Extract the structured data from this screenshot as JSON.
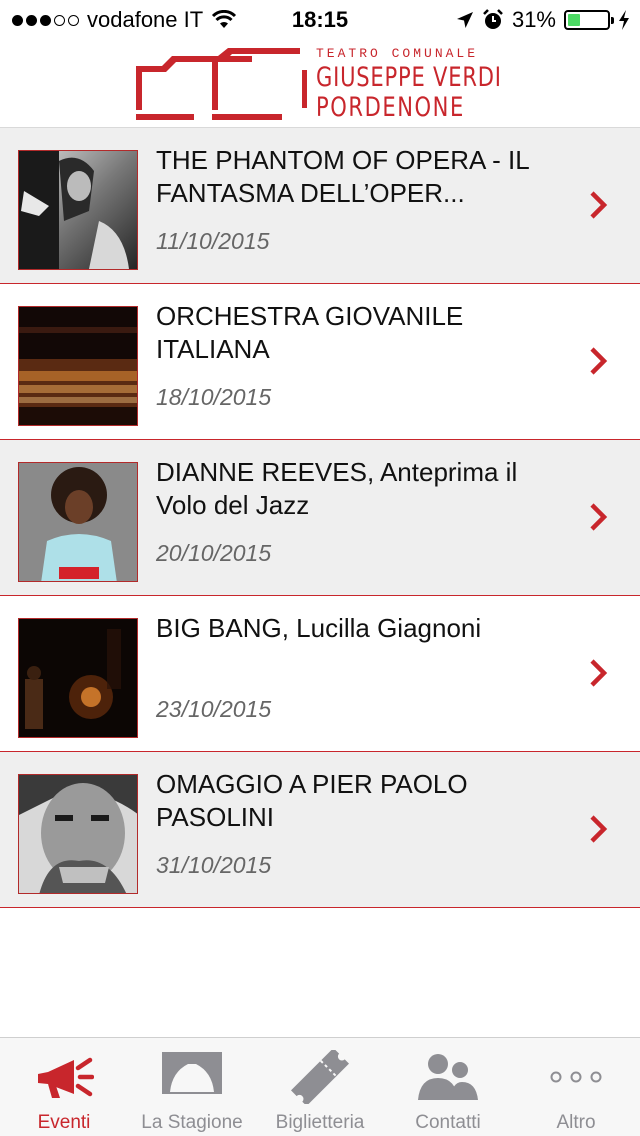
{
  "status_bar": {
    "carrier": "vodafone IT",
    "time": "18:15",
    "battery": "31%",
    "battery_level": 0.31
  },
  "header": {
    "logo_line1": "TEATRO COMUNALE",
    "logo_line2": "GIUSEPPE VERDI",
    "logo_line3": "PORDENONE"
  },
  "events": [
    {
      "title": "THE PHANTOM OF OPERA - IL FANTASMA DELL’OPER...",
      "date": "11/10/2015"
    },
    {
      "title": "ORCHESTRA GIOVANILE ITALIANA",
      "date": "18/10/2015"
    },
    {
      "title": "DIANNE REEVES, Anteprima il Volo del Jazz",
      "date": "20/10/2015"
    },
    {
      "title": "BIG BANG, Lucilla Giagnoni",
      "date": "23/10/2015"
    },
    {
      "title": "OMAGGIO A PIER PAOLO PASOLINI",
      "date": "31/10/2015"
    }
  ],
  "tabs": [
    {
      "label": "Eventi",
      "icon": "megaphone-icon",
      "active": true
    },
    {
      "label": "La Stagione",
      "icon": "stage-icon",
      "active": false
    },
    {
      "label": "Biglietteria",
      "icon": "ticket-icon",
      "active": false
    },
    {
      "label": "Contatti",
      "icon": "people-icon",
      "active": false
    },
    {
      "label": "Altro",
      "icon": "more-icon",
      "active": false
    }
  ],
  "colors": {
    "accent": "#c8262c",
    "inactive_tab": "#8e8e93",
    "row_shade": "#efefef",
    "battery": "#4cd964"
  }
}
